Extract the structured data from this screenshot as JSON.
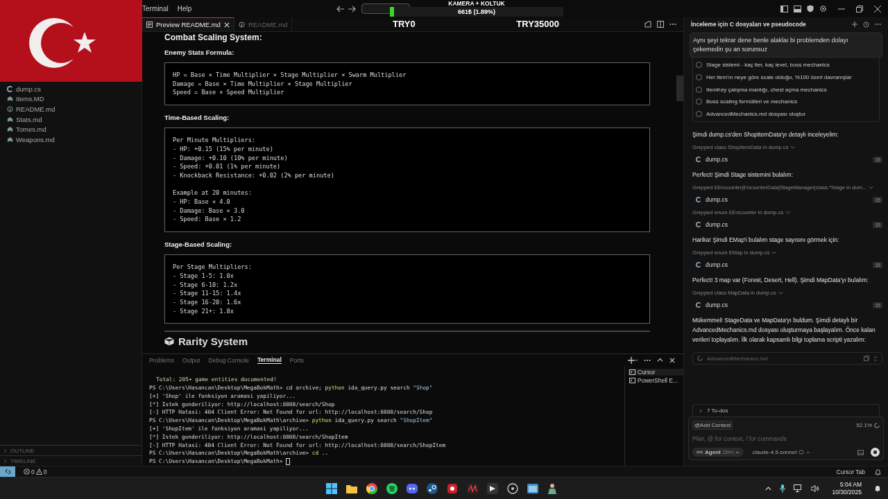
{
  "titlebar": {
    "menu": [
      "Terminal",
      "Help"
    ]
  },
  "overlay": {
    "title": "KAMERA + KOLTUK",
    "level": 0.0189,
    "amount": "661₺ (1.89%)",
    "min_label": "TRY0",
    "max_label": "TRY35000"
  },
  "editor_tabs": [
    {
      "label": "Preview README.md",
      "selected": true,
      "kind": "preview"
    },
    {
      "label": "README.md",
      "selected": false,
      "kind": "info"
    }
  ],
  "explorer": {
    "files": [
      {
        "name": "dump.cs",
        "kind": "cs"
      },
      {
        "name": "Items.MD",
        "kind": "md"
      },
      {
        "name": "README.md",
        "kind": "info"
      },
      {
        "name": "Stats.md",
        "kind": "md"
      },
      {
        "name": "Tomes.md",
        "kind": "md"
      },
      {
        "name": "Weapons.md",
        "kind": "md"
      }
    ],
    "sections": [
      "OUTLINE",
      "TIMELINE"
    ]
  },
  "preview": {
    "blocks": [
      {
        "kind": "h2",
        "text": "Combat Scaling System:"
      },
      {
        "kind": "label",
        "text": "Enemy Stats Formula:"
      },
      {
        "kind": "code",
        "lines": [
          "HP = Base × Time Multiplier × Stage Multiplier × Swarm Multiplier",
          "Damage = Base × Time Multiplier × Stage Multiplier",
          "Speed = Base × Speed Multiplier"
        ]
      },
      {
        "kind": "label",
        "text": "Time-Based Scaling:"
      },
      {
        "kind": "code",
        "lines": [
          "Per Minute Multipliers:",
          "- HP: +0.15 (15% per minute)",
          "- Damage: +0.10 (10% per minute)",
          "- Speed: +0.01 (1% per minute)",
          "- Knockback Resistance: +0.02 (2% per minute)"
        ],
        "more_lines": [
          "Example at 20 minutes:",
          "- HP: Base × 4.0",
          "- Damage: Base × 3.0",
          "- Speed: Base × 1.2"
        ]
      },
      {
        "kind": "label",
        "text": "Stage-Based Scaling:"
      },
      {
        "kind": "code",
        "lines": [
          "Per Stage Multipliers:",
          "- Stage 1-5: 1.0x",
          "- Stage 6-10: 1.2x",
          "- Stage 11-15: 1.4x",
          "- Stage 16-20: 1.6x",
          "- Stage 21+: 1.8x"
        ]
      },
      {
        "kind": "rule"
      },
      {
        "kind": "h1",
        "text": "Rarity System"
      }
    ]
  },
  "panel": {
    "tabs": [
      {
        "label": "Problems",
        "selected": false
      },
      {
        "label": "Output",
        "selected": false
      },
      {
        "label": "Debug Console",
        "selected": false
      },
      {
        "label": "Terminal",
        "selected": true
      },
      {
        "label": "Ports",
        "selected": false
      }
    ],
    "lines": [
      {
        "kind": "summary",
        "text": "Total: 205+ game entities documented!"
      },
      {
        "kind": "prompt",
        "prompt": "PS C:\\Users\\Hasancan\\Desktop\\MegaBokMath>",
        "parts": [
          {
            "kind": "plain",
            "text": "cd archive;"
          },
          {
            "kind": "exe",
            "text": "python"
          },
          {
            "kind": "plain",
            "text": "ida_query.py search"
          },
          {
            "kind": "str",
            "text": "\"Shop\""
          }
        ]
      },
      {
        "kind": "output",
        "text": "[+] 'Shop' ile fonksiyon aramasi yapiliyor..."
      },
      {
        "kind": "output",
        "text": "[*] Istek gonderiliyor: http://localhost:8080/search/Shop"
      },
      {
        "kind": "output",
        "text": "[-] HTTP Hatasi: 404 Client Error: Not Found for url: http://localhost:8080/search/Shop"
      },
      {
        "kind": "prompt",
        "prompt": "PS C:\\Users\\Hasancan\\Desktop\\MegaBokMath\\archive>",
        "parts": [
          {
            "kind": "exe",
            "text": "python"
          },
          {
            "kind": "plain",
            "text": "ida_query.py search"
          },
          {
            "kind": "str",
            "text": "\"ShopItem\""
          }
        ]
      },
      {
        "kind": "output",
        "text": "[+] 'ShopItem' ile fonksiyon aramasi yapiliyor..."
      },
      {
        "kind": "output",
        "text": "[*] Istek gonderiliyor: http://localhost:8080/search/ShopItem"
      },
      {
        "kind": "output",
        "text": "[-] HTTP Hatasi: 404 Client Error: Not Found for url: http://localhost:8080/search/ShopItem"
      },
      {
        "kind": "prompt",
        "prompt": "PS C:\\Users\\Hasancan\\Desktop\\MegaBokMath\\archive>",
        "parts": [
          {
            "kind": "exe",
            "text": "cd"
          },
          {
            "kind": "plain",
            "text": ".."
          }
        ]
      },
      {
        "kind": "prompt",
        "prompt": "PS C:\\Users\\Hasancan\\Desktop\\MegaBokMath>",
        "cursor": true
      }
    ],
    "terminals": [
      {
        "name": "Cursor",
        "selected": true
      },
      {
        "name": "PowerShell E...",
        "selected": false
      }
    ]
  },
  "chat": {
    "title": "İnceleme için C dosyaları ve pseudocode",
    "user_message": "Aynı şeyi tekrar dene benle alaklaı bi problemden dolayı çekemedin şu an sorunsuz",
    "todos": [
      {
        "text": "Stage sistemi - kaç tier, kaç level, boss mechanics",
        "checked": false
      },
      {
        "text": "Her item'ın neye göre scale olduğu, %100 üzeri davranışlar",
        "checked": false
      },
      {
        "text": "ItemKey çalışma mantığı, chest açma mechanics",
        "checked": false
      },
      {
        "text": "Boss scaling formülleri ve mechanics",
        "checked": false
      },
      {
        "text": "AdvancedMechanics.md dosyası oluştur",
        "checked": false
      }
    ],
    "items": [
      {
        "kind": "text",
        "text": "Şimdi dump.cs'den ShopItemData'yı detaylı inceleyelim:"
      },
      {
        "kind": "tool",
        "text": "Grepped class ShopItemData in dump.cs"
      },
      {
        "kind": "file",
        "text": "dump.cs",
        "count": "15"
      },
      {
        "kind": "text",
        "text": "Perfect! Şimdi Stage sistemini bulalım:"
      },
      {
        "kind": "tool",
        "text": "Grepped EEncounter|EncounterData|StageManager|class.*Stage in dum..."
      },
      {
        "kind": "file",
        "text": "dump.cs",
        "count": "15"
      },
      {
        "kind": "tool",
        "text": "Grepped enum EEncounter in dump.cs"
      },
      {
        "kind": "file",
        "text": "dump.cs",
        "count": "15"
      },
      {
        "kind": "text",
        "text": "Harika! Şimdi EMap'i bulalım stage sayısını görmek için:"
      },
      {
        "kind": "tool",
        "text": "Grepped enum EMap in dump.cs"
      },
      {
        "kind": "file",
        "text": "dump.cs",
        "count": "15"
      },
      {
        "kind": "text",
        "text": "Perfect! 3 map var (Forest, Desert, Hell). Şimdi MapData'yı bulalım:"
      },
      {
        "kind": "tool",
        "text": "Grepped class MapData in dump.cs"
      },
      {
        "kind": "file",
        "text": "dump.cs",
        "count": "15"
      },
      {
        "kind": "text",
        "text": "Mükemmel! StageData ve MapData'yı buldum. Şimdi detaylı bir AdvancedMechanics.md dosyası oluşturmaya başlayalım. Önce kalan verileri toplayalım. İlk olarak kapsamlı bilgi toplama scripti yazalım:"
      },
      {
        "kind": "writing",
        "text": "AdvancedMechanics.md"
      }
    ],
    "todos_summary": "7 To-dos",
    "composer": {
      "add_context": "@Add Context",
      "usage": "52.1%",
      "placeholder": "Plan, @ for context, / for commands",
      "mode": "Agent",
      "mode_shortcut": "Ctrl+I",
      "model": "claude-4.5-sonnet"
    }
  },
  "status_bar": {
    "errors": "0",
    "warnings": "0",
    "right_label": "Cursor Tab"
  },
  "taskbar": {
    "time": "5:04 AM",
    "date": "10/30/2025"
  }
}
